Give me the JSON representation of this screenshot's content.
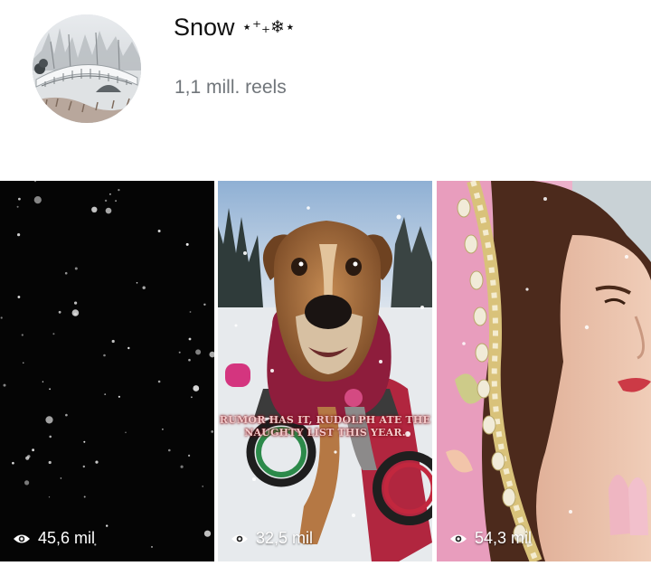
{
  "profile": {
    "title": "Snow",
    "title_decoration": "⋆⁺₊❄⋆",
    "subtitle": "1,1 mill. reels",
    "avatar_icon": "snowy-bridge-photo"
  },
  "reels": [
    {
      "views": "45,6 mil",
      "icon": "eye-icon",
      "theme": "falling-snow-night",
      "caption": ""
    },
    {
      "views": "32,5 mil",
      "icon": "eye-icon",
      "theme": "dog-in-snow",
      "caption": "RUMOR HAS IT, RUDOLPH ATE THE NAUGHTY LIST THIS YEAR."
    },
    {
      "views": "54,3 mil",
      "icon": "eye-icon",
      "theme": "woman-with-veil",
      "caption": ""
    }
  ],
  "colors": {
    "subtitle": "#70757a",
    "caption_text": "#f2c9c9",
    "caption_shadow": "#7a0c14"
  }
}
